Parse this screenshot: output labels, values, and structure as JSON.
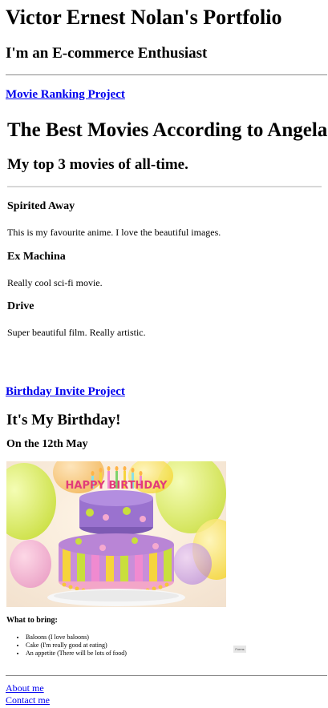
{
  "header": {
    "title": "Victor Ernest Nolan's Portfolio",
    "subtitle": "I'm an E-commerce Enthusiast"
  },
  "movie_project": {
    "link_label": "Movie Ranking Project",
    "heading": "The Best Movies According to Angela",
    "subheading": "My top 3 movies of all-time.",
    "movies": [
      {
        "title": "Spirited Away",
        "description": "This is my favourite anime. I love the beautiful images."
      },
      {
        "title": "Ex Machina",
        "description": "Really cool sci-fi movie."
      },
      {
        "title": "Drive",
        "description": "Super beautiful film. Really artistic."
      }
    ]
  },
  "birthday_project": {
    "link_label": "Birthday Invite Project",
    "heading": "It's My Birthday!",
    "date": "On the 12th May",
    "cake_lettering": "HAPPY BIRTHDAY",
    "bring_heading": "What to bring:",
    "bring_items": [
      "Baloons (I love baloons)",
      "Cake (I'm really good at eating)",
      "An appetite (There will be lots of food)"
    ],
    "form_button_label": "Forms"
  },
  "footer": {
    "about_label": "About me",
    "contact_label": "Contact me"
  },
  "colors": {
    "link": "#0000ee",
    "rule": "#8a8a8a",
    "background": "#ffffff"
  }
}
